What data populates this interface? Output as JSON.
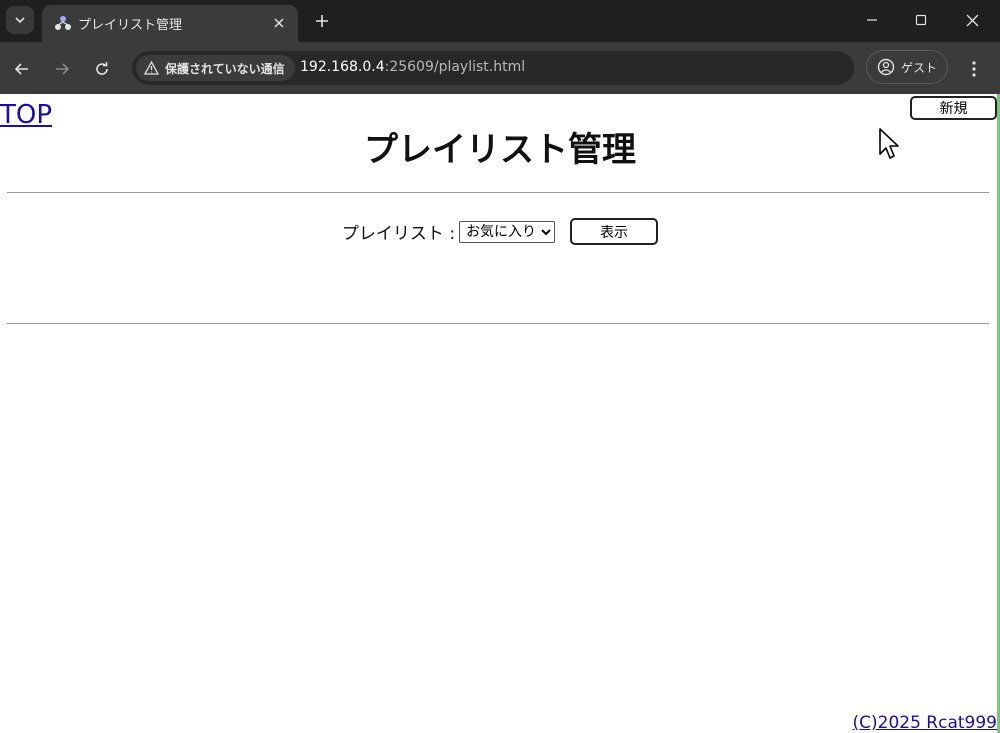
{
  "browser": {
    "tab_title": "プレイリスト管理",
    "security_label": "保護されていない通信",
    "url_host": "192.168.0.4",
    "url_rest": ":25609/playlist.html",
    "guest_label": "ゲスト"
  },
  "page": {
    "top_link": "TOP",
    "new_button": "新規",
    "title": "プレイリスト管理",
    "playlist_label": "プレイリスト :",
    "playlist_selected": "お気に入り",
    "show_button": "表示",
    "copyright": "(C)2025 Rcat999"
  },
  "colors": {
    "link": "#1a0dab",
    "chrome_bg": "#1f1f1f",
    "toolbar_bg": "#3b3b3b"
  }
}
